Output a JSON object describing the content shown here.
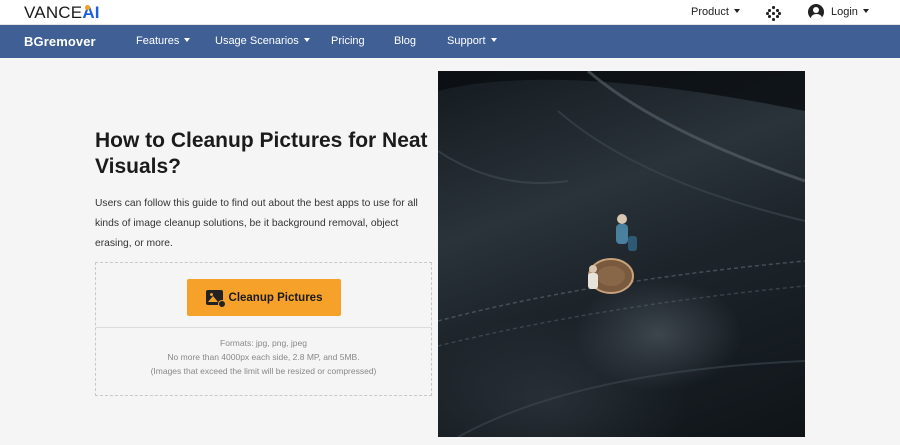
{
  "topbar": {
    "logo_main": "VANCE",
    "logo_accent": "AI",
    "product_label": "Product",
    "login_label": "Login"
  },
  "navbar": {
    "brand": "BGremover",
    "items": [
      "Features",
      "Usage Scenarios",
      "Pricing",
      "Blog",
      "Support"
    ]
  },
  "hero": {
    "title": "How to Cleanup Pictures for Neat Visuals?",
    "description": "Users can follow this guide to find out about the best apps to use for all kinds of image cleanup solutions, be it background removal, object erasing, or more."
  },
  "upload": {
    "button_label": "Cleanup Pictures",
    "formats": "Formats: jpg, png, jpeg",
    "limit": "No more than 4000px each side, 2.8 MP, and 5MB.",
    "note": "(Images that exceed the limit will be resized or compressed)"
  },
  "colors": {
    "nav_bg": "#3f5f95",
    "accent_orange": "#f5a12a",
    "logo_blue": "#1e5fd8"
  }
}
